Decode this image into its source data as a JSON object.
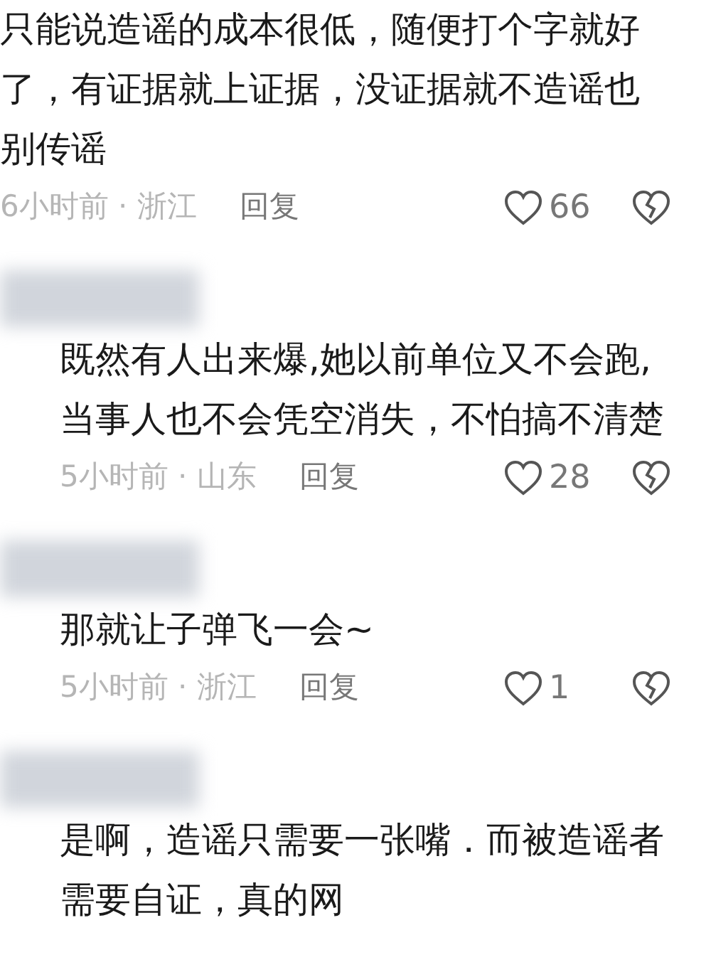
{
  "comments": [
    {
      "name_hidden": false,
      "lines": [
        "只能说造谣的成本很低，随便打个字就好",
        "了，有证据就上证据，没证据就不造谣也",
        "别传谣"
      ],
      "time": "6小时前 · 浙江",
      "reply": "回复",
      "likes": "66"
    },
    {
      "name_hidden": true,
      "lines": [
        "既然有人出来爆,她以前单位又不会跑,",
        "当事人也不会凭空消失，不怕搞不清楚"
      ],
      "time": "5小时前 · 山东",
      "reply": "回复",
      "likes": "28"
    },
    {
      "name_hidden": true,
      "lines": [
        "那就让子弹飞一会~"
      ],
      "time": "5小时前 · 浙江",
      "reply": "回复",
      "likes": "1"
    },
    {
      "name_hidden": true,
      "lines": [
        "是啊，造谣只需要一张嘴．而被造谣者",
        "需要自证，真的网"
      ]
    }
  ]
}
